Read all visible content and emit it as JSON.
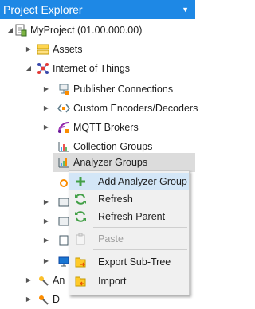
{
  "title": "Project Explorer",
  "tree": {
    "project": "MyProject (01.00.000.00)",
    "assets": "Assets",
    "iot": "Internet of Things",
    "publisher": "Publisher Connections",
    "encoders": "Custom Encoders/Decoders",
    "mqtt": "MQTT Brokers",
    "collection": "Collection Groups",
    "analyzer": "Analyzer Groups",
    "partial_a": "An",
    "partial_d": "D"
  },
  "context_menu": {
    "items": [
      {
        "label": "Add Analyzer Group",
        "icon": "plus-icon"
      },
      {
        "label": "Refresh",
        "icon": "refresh-icon"
      },
      {
        "label": "Refresh Parent",
        "icon": "refresh-icon"
      },
      {
        "label": "Paste",
        "icon": "paste-icon"
      },
      {
        "label": "Export Sub-Tree",
        "icon": "export-icon"
      },
      {
        "label": "Import",
        "icon": "import-icon"
      }
    ]
  },
  "colors": {
    "titlebar": "#1e88e5",
    "accent_green": "#43a047",
    "selected_row": "#dcdcdc",
    "menu_hover": "#d3e6f7"
  }
}
